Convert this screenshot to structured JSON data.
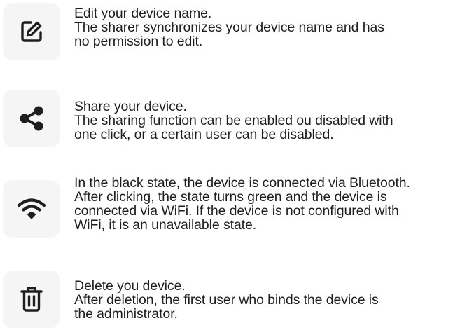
{
  "items": [
    {
      "icon": "edit-icon",
      "lines": [
        "Edit your device name.",
        "The sharer synchronizes your device name and has",
        "no permission to edit."
      ]
    },
    {
      "icon": "share-icon",
      "lines": [
        "Share your device.",
        "The sharing function can be enabled ou disabled with",
        "one click, or a certain user can be disabled."
      ]
    },
    {
      "icon": "wifi-icon",
      "lines": [
        "In the black state, the device is connected via Bluetooth.",
        "After clicking, the state turns green and the device is",
        "connected via WiFi. If the device is not configured with",
        "WiFi, it is an unavailable state."
      ]
    },
    {
      "icon": "trash-icon",
      "lines": [
        "Delete you device.",
        "After deletion, the first user who binds the device is",
        "the administrator."
      ]
    }
  ],
  "colors": {
    "icon": "#1e1e1e",
    "tile_background": "#f5f5f5",
    "text": "#1e1e1e"
  }
}
